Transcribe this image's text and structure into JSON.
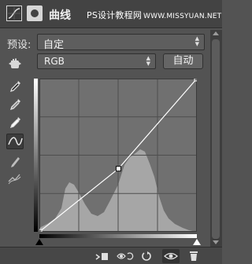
{
  "title": "曲线",
  "watermark": {
    "cn": "PS设计教程网",
    "url": "WWW.MISSYUAN.NET"
  },
  "preset": {
    "label": "预设:",
    "value": "自定"
  },
  "channel": {
    "value": "RGB"
  },
  "auto_button_label": "自动",
  "tools": [
    "on-image-adjust-icon",
    "black-point-eyedropper-icon",
    "gray-point-eyedropper-icon",
    "white-point-eyedropper-icon",
    "curve-point-tool-icon",
    "pencil-tool-icon",
    "smooth-curve-icon"
  ],
  "curve": {
    "points": [
      [
        0,
        0
      ],
      [
        128,
        105
      ],
      [
        255,
        255
      ]
    ]
  },
  "footer_icons": [
    "clip-to-layer-icon",
    "view-previous-icon",
    "reset-icon",
    "visibility-eye-icon",
    "trash-icon"
  ]
}
